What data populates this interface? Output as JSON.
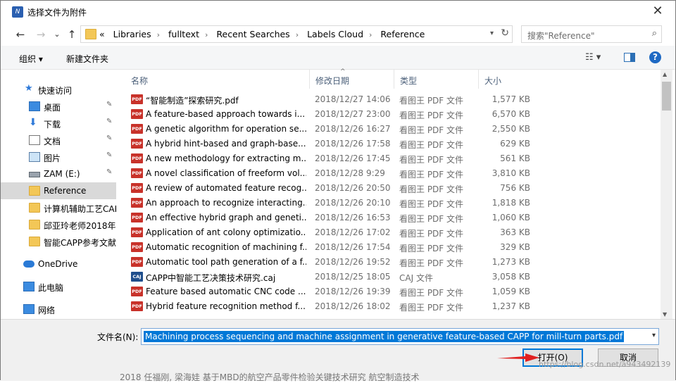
{
  "window": {
    "title": "选择文件为附件",
    "app_icon_text": "N",
    "close_glyph": "✕"
  },
  "nav": {
    "back": "←",
    "forward": "→",
    "recent": "⌄",
    "up": "↑"
  },
  "address": {
    "crumbs": [
      "Libraries",
      "fulltext",
      "Recent Searches",
      "Labels Cloud",
      "Reference"
    ],
    "prefix": "«"
  },
  "search": {
    "placeholder": "搜索\"Reference\""
  },
  "toolbar": {
    "organize": "组织 ▾",
    "new_folder": "新建文件夹"
  },
  "sidebar": {
    "items": [
      {
        "label": "快速访问",
        "icon": "star-icon",
        "pinned": false
      },
      {
        "label": "桌面",
        "icon": "desktop-icon",
        "pinned": true
      },
      {
        "label": "下载",
        "icon": "download-icon",
        "pinned": true
      },
      {
        "label": "文档",
        "icon": "documents-icon",
        "pinned": true
      },
      {
        "label": "图片",
        "icon": "pictures-icon",
        "pinned": true
      },
      {
        "label": "ZAM (E:)",
        "icon": "drive-icon",
        "pinned": true
      },
      {
        "label": "Reference",
        "icon": "folder-icon",
        "pinned": false,
        "selected": true
      },
      {
        "label": "计算机辅助工艺CAP",
        "icon": "folder-icon",
        "pinned": false
      },
      {
        "label": "邱亚玲老师2018年",
        "icon": "folder-icon",
        "pinned": false
      },
      {
        "label": "智能CAPP参考文献",
        "icon": "folder-icon",
        "pinned": false
      },
      {
        "label": "OneDrive",
        "icon": "onedrive-icon",
        "pinned": false
      },
      {
        "label": "此电脑",
        "icon": "computer-icon",
        "pinned": false
      },
      {
        "label": "网络",
        "icon": "network-icon",
        "pinned": false
      }
    ]
  },
  "columns": [
    "名称",
    "修改日期",
    "类型",
    "大小"
  ],
  "files": [
    {
      "name": "“智能制造”探索研究.pdf",
      "date": "2018/12/27 14:06",
      "type": "看图王 PDF 文件",
      "size": "1,577 KB",
      "kind": "pdf"
    },
    {
      "name": "A feature-based approach towards i...",
      "date": "2018/12/27 23:00",
      "type": "看图王 PDF 文件",
      "size": "6,570 KB",
      "kind": "pdf"
    },
    {
      "name": "A genetic algorithm for operation se...",
      "date": "2018/12/26 16:27",
      "type": "看图王 PDF 文件",
      "size": "2,550 KB",
      "kind": "pdf"
    },
    {
      "name": "A hybrid hint-based and graph-base...",
      "date": "2018/12/26 17:58",
      "type": "看图王 PDF 文件",
      "size": "629 KB",
      "kind": "pdf"
    },
    {
      "name": "A new methodology for extracting m...",
      "date": "2018/12/26 17:45",
      "type": "看图王 PDF 文件",
      "size": "561 KB",
      "kind": "pdf"
    },
    {
      "name": "A novel classification of freeform vol...",
      "date": "2018/12/28 9:29",
      "type": "看图王 PDF 文件",
      "size": "3,810 KB",
      "kind": "pdf"
    },
    {
      "name": "A review of automated feature recog...",
      "date": "2018/12/26 20:50",
      "type": "看图王 PDF 文件",
      "size": "756 KB",
      "kind": "pdf"
    },
    {
      "name": "An approach to recognize interacting...",
      "date": "2018/12/26 20:10",
      "type": "看图王 PDF 文件",
      "size": "1,818 KB",
      "kind": "pdf"
    },
    {
      "name": "An effective hybrid graph and geneti...",
      "date": "2018/12/26 16:53",
      "type": "看图王 PDF 文件",
      "size": "1,060 KB",
      "kind": "pdf"
    },
    {
      "name": "Application of ant colony optimizatio...",
      "date": "2018/12/26 17:02",
      "type": "看图王 PDF 文件",
      "size": "363 KB",
      "kind": "pdf"
    },
    {
      "name": "Automatic recognition of machining f...",
      "date": "2018/12/26 17:54",
      "type": "看图王 PDF 文件",
      "size": "329 KB",
      "kind": "pdf"
    },
    {
      "name": "Automatic tool path generation of a f...",
      "date": "2018/12/26 19:52",
      "type": "看图王 PDF 文件",
      "size": "1,273 KB",
      "kind": "pdf"
    },
    {
      "name": "CAPP中智能工艺决策技术研究.caj",
      "date": "2018/12/25 18:05",
      "type": "CAJ 文件",
      "size": "3,058 KB",
      "kind": "caj"
    },
    {
      "name": "Feature based automatic CNC code ...",
      "date": "2018/12/26 19:39",
      "type": "看图王 PDF 文件",
      "size": "1,059 KB",
      "kind": "pdf"
    },
    {
      "name": "Hybrid feature recognition method f...",
      "date": "2018/12/26 18:02",
      "type": "看图王 PDF 文件",
      "size": "1,237 KB",
      "kind": "pdf"
    }
  ],
  "file_icon_labels": {
    "pdf": "PDF",
    "caj": "CAJ"
  },
  "filename": {
    "label": "文件名(N):",
    "value": "Machining process sequencing and machine assignment in generative feature-based CAPP for mill-turn parts.pdf"
  },
  "buttons": {
    "open": "打开(O)",
    "cancel": "取消"
  },
  "watermark": "https://blog.csdn.net/a943492139",
  "background_text": "2018    任福刚, 梁海娃            基于MBD的航空产品零件检验关键技术研究            航空制造技术",
  "colors": {
    "accent": "#0078d7",
    "pdf_icon": "#c8322a",
    "caj_icon": "#1f4e8c",
    "folder": "#f3c757"
  }
}
